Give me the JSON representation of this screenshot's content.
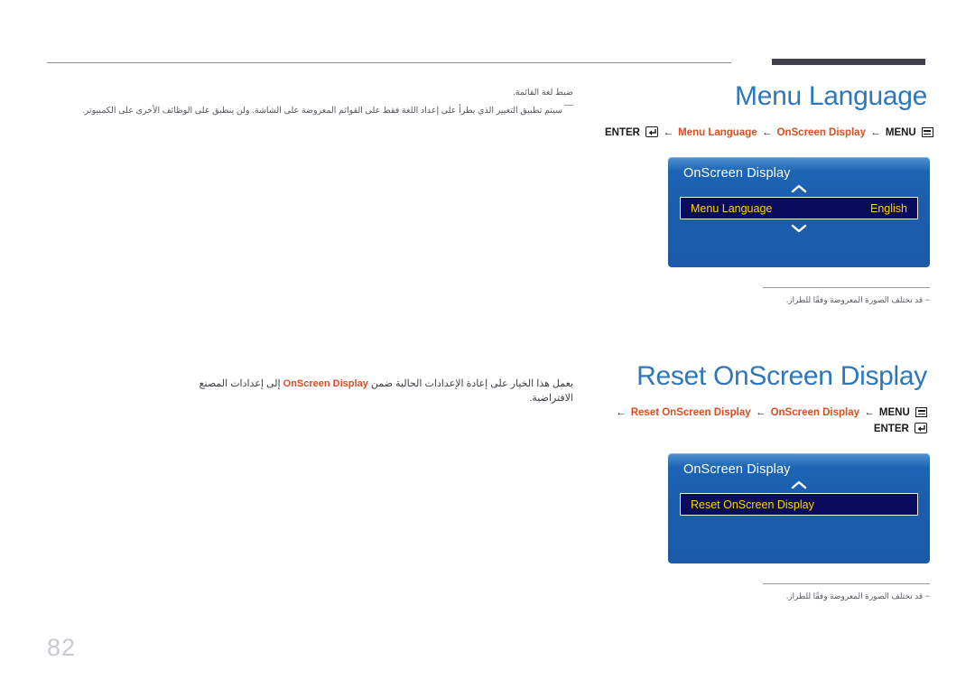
{
  "page": {
    "number": "82"
  },
  "sections": [
    {
      "id": "menu-language",
      "title": "Menu Language",
      "breadcrumb_lines": [
        [
          {
            "text": "ENTER",
            "kind": "sys"
          },
          {
            "text": "enter-icon",
            "kind": "icon-enter"
          },
          {
            "text": "←",
            "kind": "arrow"
          },
          {
            "text": "Menu Language",
            "kind": "item"
          },
          {
            "text": "←",
            "kind": "arrow"
          },
          {
            "text": "OnScreen Display",
            "kind": "item"
          },
          {
            "text": "←",
            "kind": "arrow"
          },
          {
            "text": "MENU",
            "kind": "sys"
          },
          {
            "text": "menu-icon",
            "kind": "icon-menu"
          }
        ]
      ],
      "osd": {
        "title": "OnScreen Display",
        "has_up_chevron": true,
        "has_down_chevron": true,
        "row_label": "Menu Language",
        "row_value": "English"
      },
      "footnote": "− قد تختلف الصورة المعروضة وفقًا للطراز."
    },
    {
      "id": "reset-onscreen-display",
      "title": "Reset OnScreen Display",
      "breadcrumb_lines": [
        [
          {
            "text": "←",
            "kind": "arrow"
          },
          {
            "text": "Reset OnScreen Display",
            "kind": "item"
          },
          {
            "text": "←",
            "kind": "arrow"
          },
          {
            "text": "OnScreen Display",
            "kind": "item"
          },
          {
            "text": "←",
            "kind": "arrow"
          },
          {
            "text": "MENU",
            "kind": "sys"
          },
          {
            "text": "menu-icon",
            "kind": "icon-menu"
          }
        ],
        [
          {
            "text": "ENTER",
            "kind": "sys"
          },
          {
            "text": "enter-icon",
            "kind": "icon-enter"
          }
        ]
      ],
      "osd": {
        "title": "OnScreen Display",
        "has_up_chevron": true,
        "has_down_chevron": false,
        "row_label": "Reset OnScreen Display",
        "row_value": ""
      },
      "footnote": "− قد تختلف الصورة المعروضة وفقًا للطراز."
    }
  ],
  "body": {
    "menu_language_heading": "ضبط لغة القائمة.",
    "menu_language_note": "سيتم تطبيق التغيير الذي يطرأ على إعداد اللغة فقط على القوائم المعروضة على الشاشة. ولن ينطبق على الوظائف الأخرى على الكمبيوتر.",
    "reset_text_before": "يعمل هذا الخيار على إعادة الإعدادات الحالية ضمن",
    "reset_text_highlight": "OnScreen Display",
    "reset_text_after": "إلى إعدادات المصنع الافتراضية."
  },
  "colors": {
    "heading": "#2e77bb",
    "breadcrumb_item": "#d94e1f",
    "osd_row_bg": "#0a0a5e",
    "osd_row_text": "#ffd200",
    "panel_blue": "#1c5fae",
    "rule_dark": "#413f4d",
    "page_number": "#c9c9d2"
  }
}
